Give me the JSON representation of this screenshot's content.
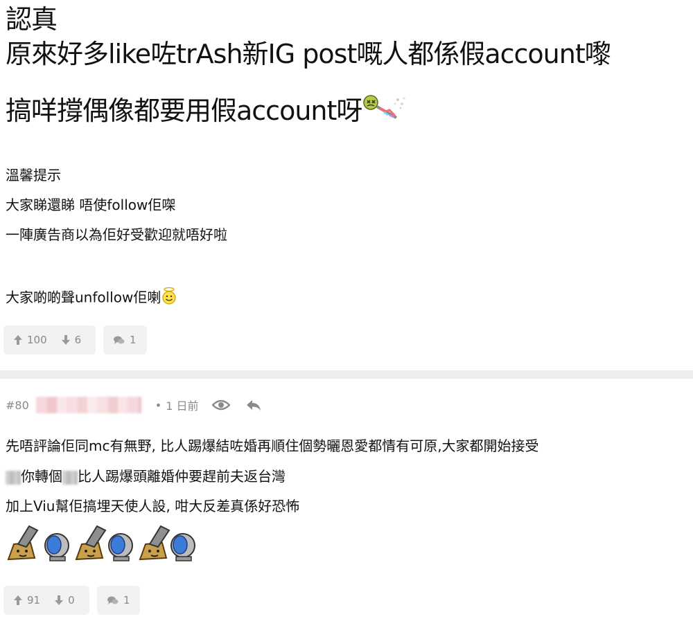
{
  "post1": {
    "title_lines": [
      "認真",
      "原來好多like咗trAsh新IG post嘅人都係假account嚟",
      "搞咩撐偶像都要用假account呀"
    ],
    "body_lines": [
      "溫馨提示",
      "大家睇還睇 唔使follow佢㗎",
      "一陣廣告商以為佢好受歡迎就唔好啦",
      "大家啲啲聲unfollow佢喇"
    ],
    "upvotes": "100",
    "downvotes": "6",
    "comments": "1"
  },
  "post2": {
    "number": "#80",
    "time": "1 日前",
    "lines": [
      "先唔評論佢同mc有無野, 比人踢爆結咗婚再順住個勢曬恩愛都情有可原,大家都開始接受",
      "你轉個",
      "比人踢爆頭離婚仲要趕前夫返台灣",
      "加上Viu幫佢搞埋天使人設, 咁大反差真係好恐怖"
    ],
    "upvotes": "91",
    "downvotes": "0",
    "comments": "1"
  },
  "colors": {
    "text": "#111111",
    "muted": "#8a8a8a",
    "vote_bg": "#f2f2f2",
    "divider": "#eeeeee"
  }
}
